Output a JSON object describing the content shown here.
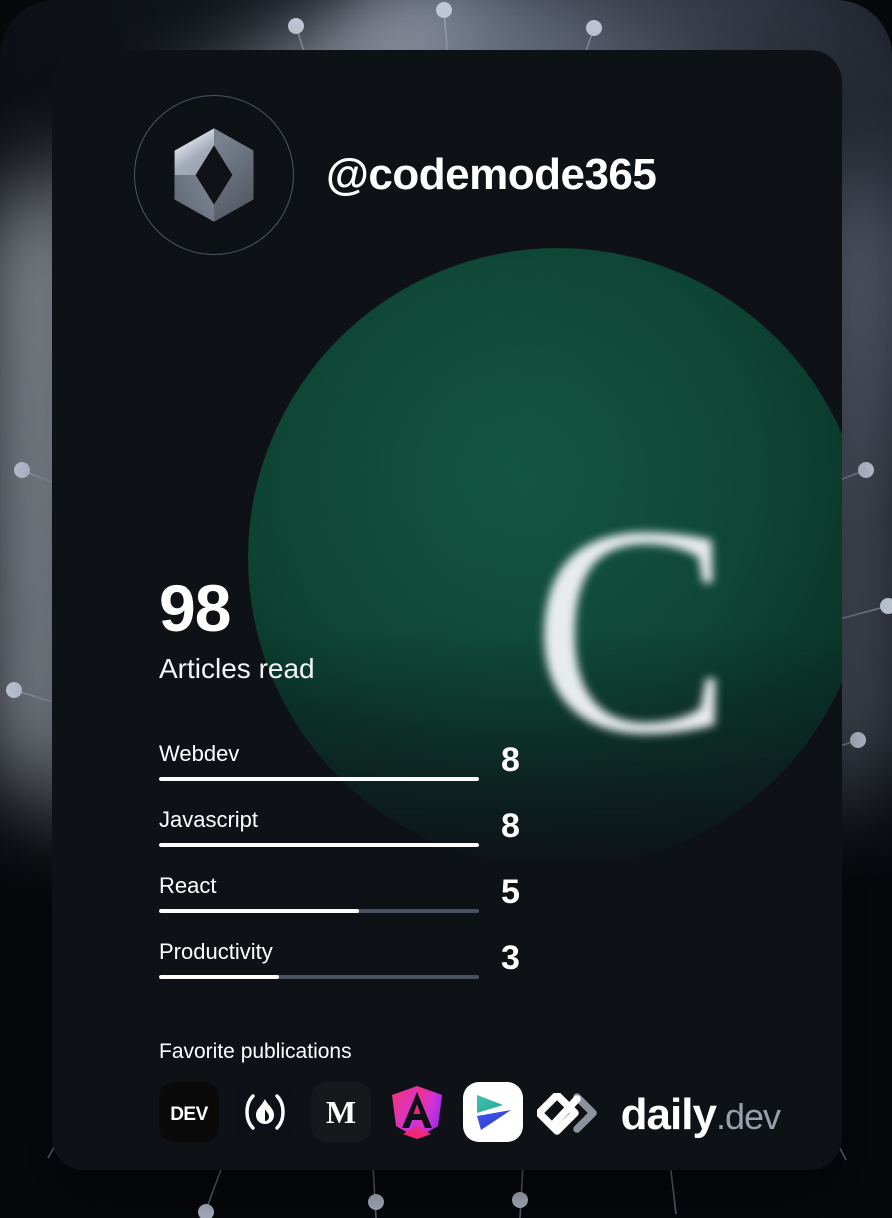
{
  "card": {
    "username": "@codemode365",
    "avatar_icon": "hexagon-diamond-logo",
    "badge_letter": "C",
    "badge_color": "#0d4132",
    "card_bg": "#0e1217"
  },
  "stats": {
    "read_count": "98",
    "read_label": "Articles read"
  },
  "tags": [
    {
      "name": "Webdev",
      "value": "8",
      "percent": 100
    },
    {
      "name": "Javascript",
      "value": "8",
      "percent": 100
    },
    {
      "name": "React",
      "value": "5",
      "percent": 62.5
    },
    {
      "name": "Productivity",
      "value": "3",
      "percent": 37.5
    }
  ],
  "publications": {
    "label": "Favorite publications",
    "items": [
      {
        "name": "DEV Community",
        "icon": "dev-icon"
      },
      {
        "name": "Hashnode",
        "icon": "hashnode-icon"
      },
      {
        "name": "Medium",
        "icon": "medium-icon"
      },
      {
        "name": "Angular Blog",
        "icon": "angular-icon"
      },
      {
        "name": "Generic Blog",
        "icon": "play-swoosh-icon"
      }
    ]
  },
  "brand": {
    "name": "daily",
    "tld": ".dev",
    "mark": "daily-dev-logo-icon"
  }
}
